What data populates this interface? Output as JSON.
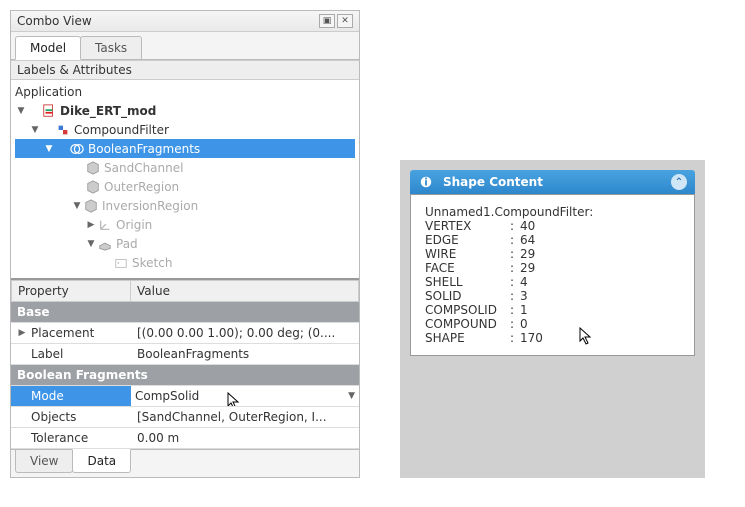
{
  "combo": {
    "title": "Combo View",
    "tabs_top": {
      "model": "Model",
      "tasks": "Tasks"
    },
    "labels_attrs": "Labels & Attributes",
    "app_label": "Application",
    "tree": {
      "root": "Dike_ERT_mod",
      "compound": "CompoundFilter",
      "bool": "BooleanFragments",
      "sand": "SandChannel",
      "outer": "OuterRegion",
      "inv": "InversionRegion",
      "origin": "Origin",
      "pad": "Pad",
      "sketch": "Sketch"
    },
    "prop_headers": {
      "prop": "Property",
      "val": "Value"
    },
    "groups": {
      "base": "Base",
      "boolf": "Boolean Fragments"
    },
    "props": {
      "placement_k": "Placement",
      "placement_v": "[(0.00 0.00 1.00); 0.00 deg; (0....",
      "label_k": "Label",
      "label_v": "BooleanFragments",
      "mode_k": "Mode",
      "mode_v": "CompSolid",
      "objects_k": "Objects",
      "objects_v": "[SandChannel, OuterRegion, I...",
      "tol_k": "Tolerance",
      "tol_v": "0.00 m"
    },
    "tabs_bottom": {
      "view": "View",
      "data": "Data"
    }
  },
  "shape": {
    "title": "Shape Content",
    "obj": "Unnamed1.CompoundFilter:",
    "rows": [
      {
        "k": "VERTEX",
        "v": "40"
      },
      {
        "k": "EDGE",
        "v": "64"
      },
      {
        "k": "WIRE",
        "v": "29"
      },
      {
        "k": "FACE",
        "v": "29"
      },
      {
        "k": "SHELL",
        "v": "4"
      },
      {
        "k": "SOLID",
        "v": "3"
      },
      {
        "k": "COMPSOLID",
        "v": "1"
      },
      {
        "k": "COMPOUND",
        "v": "0"
      },
      {
        "k": "SHAPE",
        "v": "170"
      }
    ]
  }
}
